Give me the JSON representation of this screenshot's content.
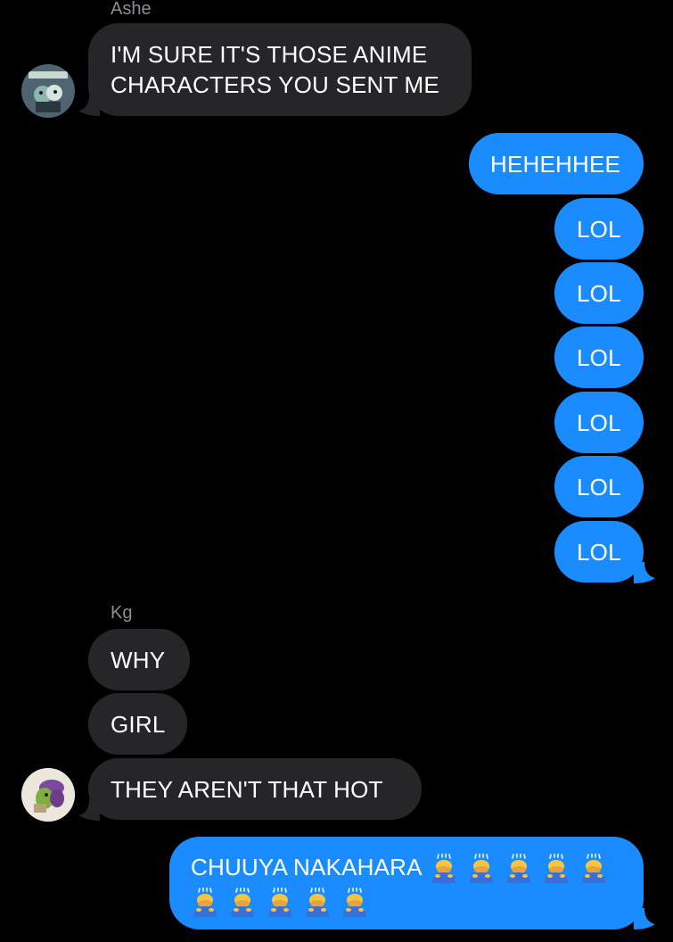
{
  "colors": {
    "background": "#000000",
    "incoming_bubble": "#262628",
    "outgoing_bubble": "#1a8cff",
    "sender_name": "#8e8e93",
    "text": "#ffffff"
  },
  "thread": {
    "group1": {
      "sender": "Ashe",
      "message": "I'M SURE IT'S THOSE ANIME CHARACTERS YOU SENT ME",
      "avatar_icon": "ashe-avatar-icon"
    },
    "outgoing_group": [
      "HEHEHHEE",
      "LOL",
      "LOL",
      "LOL",
      "LOL",
      "LOL",
      "LOL"
    ],
    "group2": {
      "sender": "Kg",
      "messages": [
        "WHY",
        "GIRL",
        "THEY AREN'T THAT HOT"
      ],
      "avatar_icon": "kg-avatar-icon"
    },
    "last_outgoing": {
      "text": "CHUUYA NAKAHARA",
      "emoji": "person-bowing-emoji",
      "emoji_count": 10
    }
  }
}
